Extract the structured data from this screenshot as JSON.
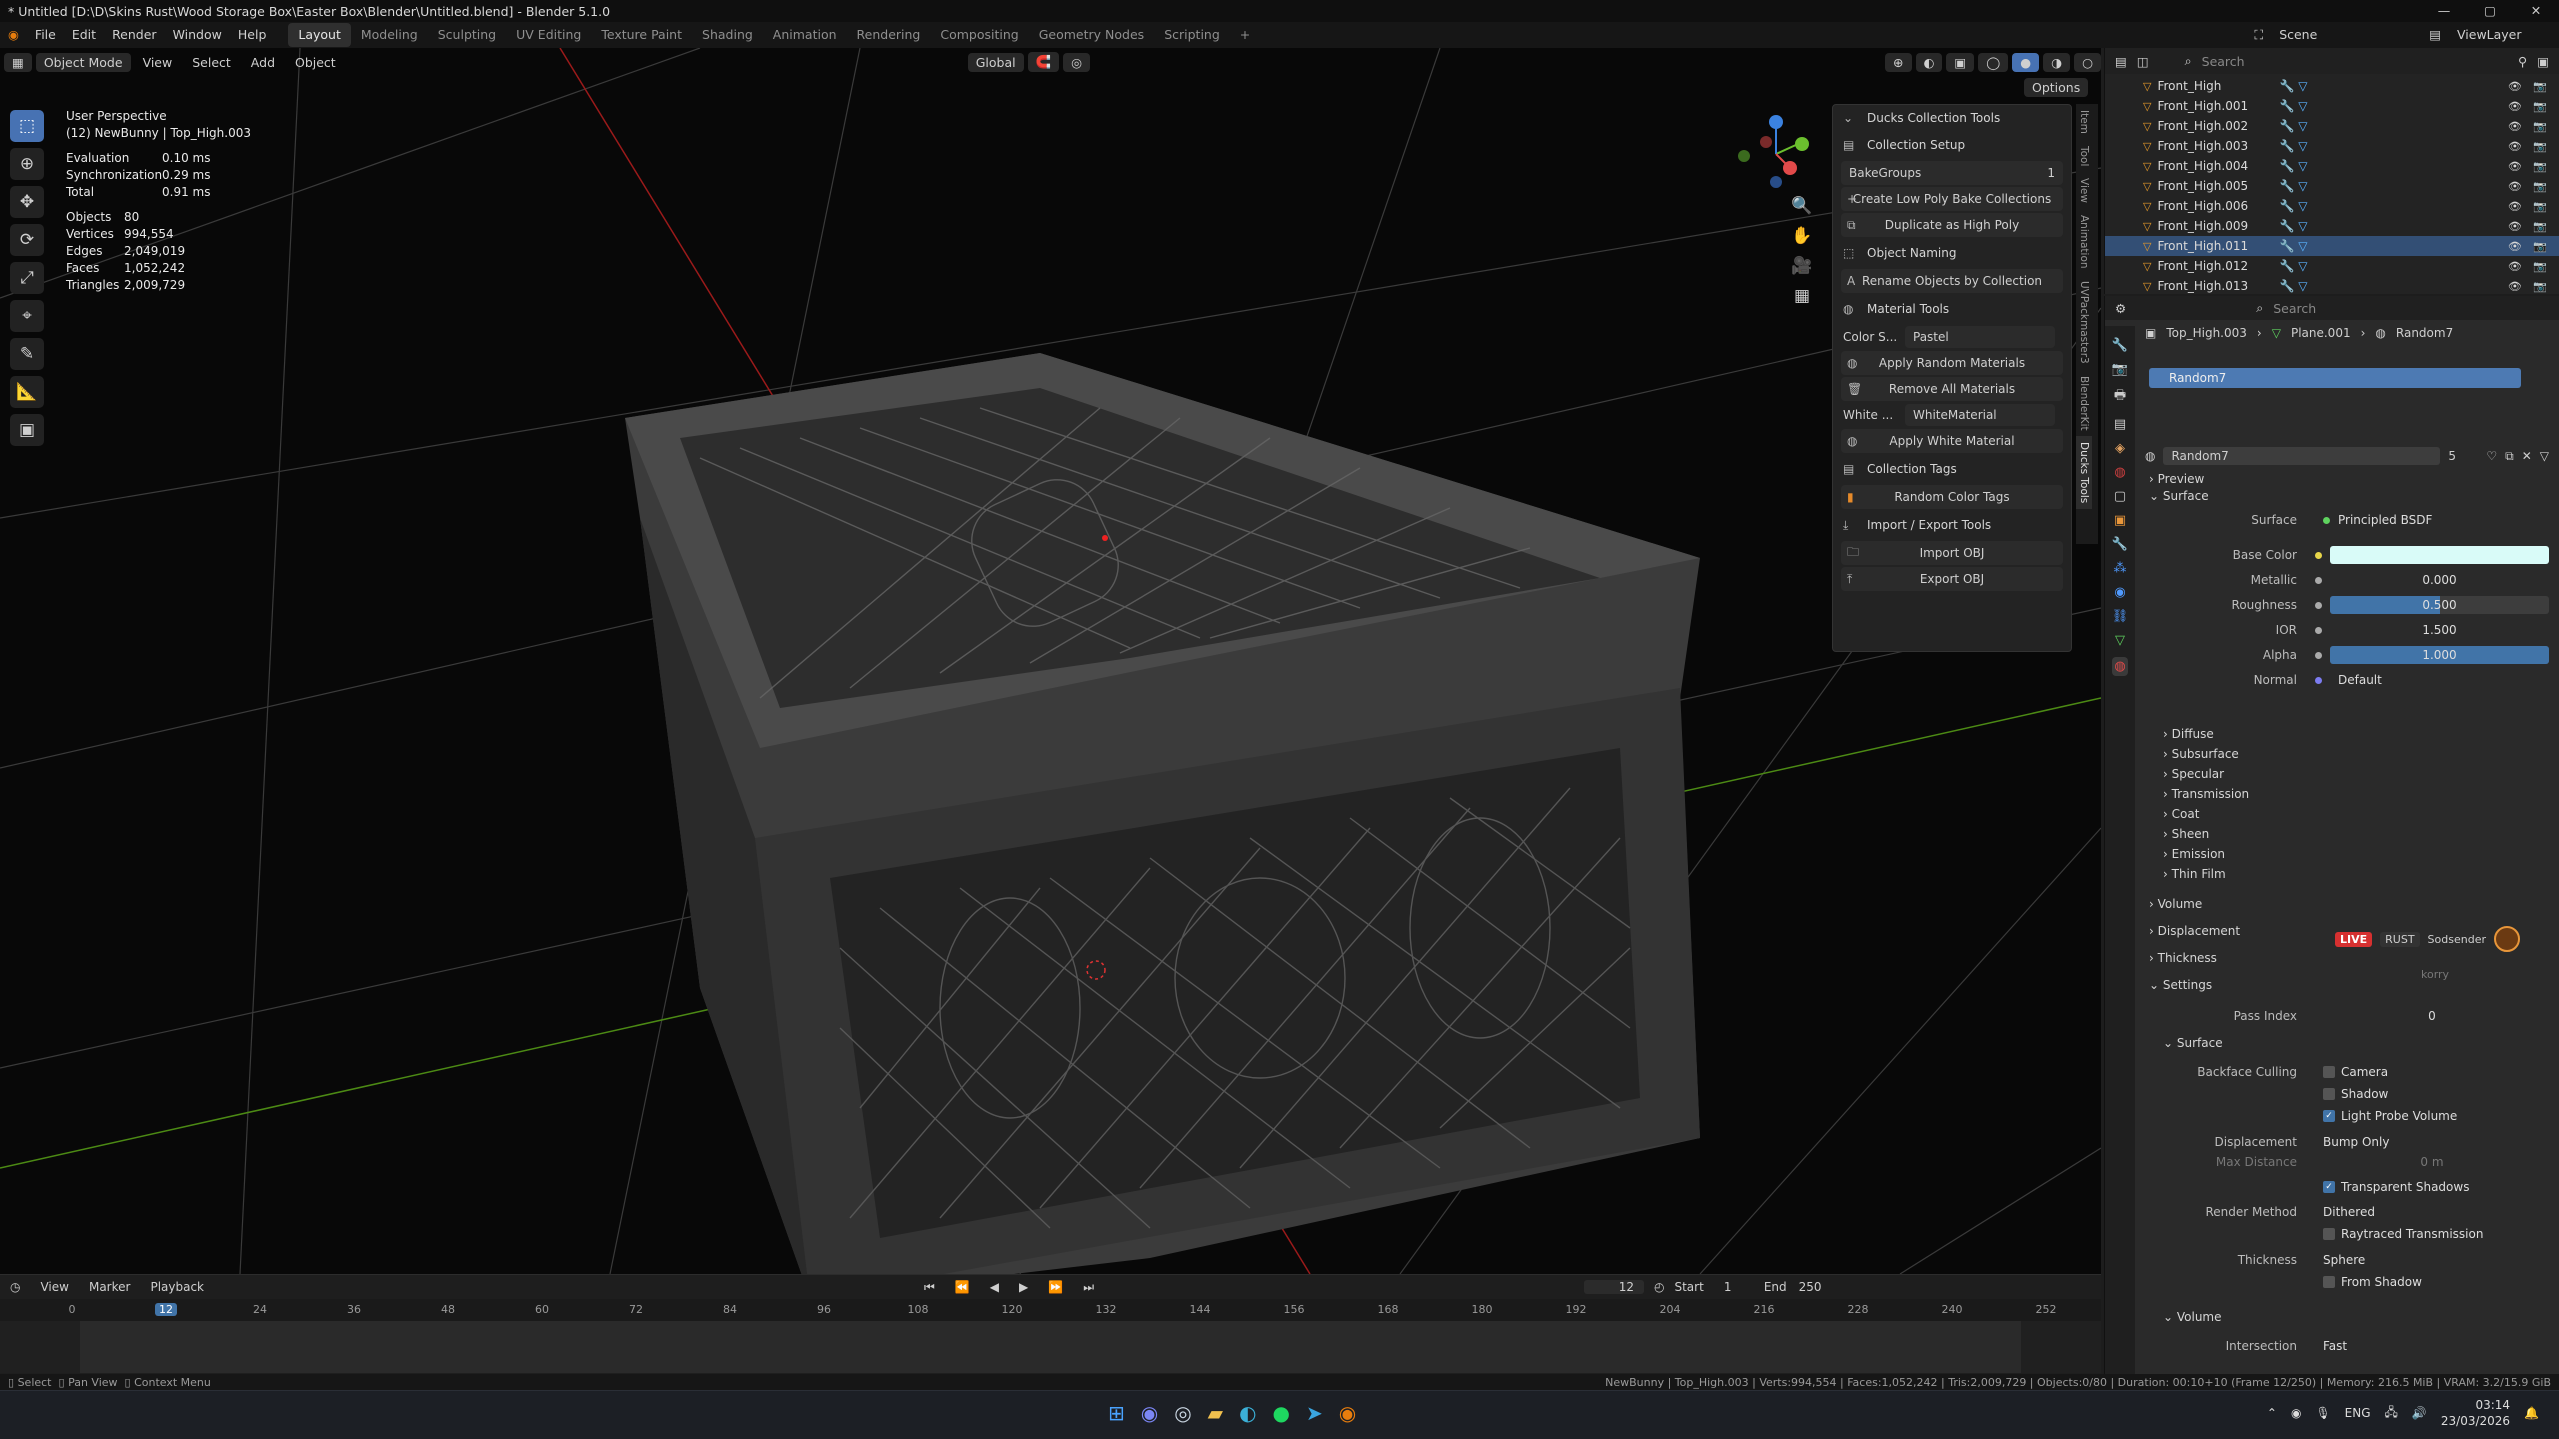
{
  "window": {
    "title": "* Untitled [D:\\D\\Skins Rust\\Wood Storage Box\\Easter Box\\Blender\\Untitled.blend] - Blender 5.1.0"
  },
  "menu": [
    "File",
    "Edit",
    "Render",
    "Window",
    "Help"
  ],
  "workspaces": [
    "Layout",
    "Modeling",
    "Sculpting",
    "UV Editing",
    "Texture Paint",
    "Shading",
    "Animation",
    "Rendering",
    "Compositing",
    "Geometry Nodes",
    "Scripting"
  ],
  "scene": {
    "label": "Scene",
    "view_layer": "ViewLayer"
  },
  "viewport_header": {
    "mode": "Object Mode",
    "view": "View",
    "select": "Select",
    "add": "Add",
    "object": "Object",
    "transform": "Global",
    "options": "Options"
  },
  "overlay": {
    "perspective": "User Perspective",
    "object": "(12) NewBunny | Top_High.003",
    "timing": [
      [
        "Evaluation",
        "0.10 ms"
      ],
      [
        "Synchronization",
        "0.29 ms"
      ],
      [
        "Total",
        "0.91 ms"
      ]
    ],
    "stats": [
      [
        "Objects",
        "80"
      ],
      [
        "Vertices",
        "994,554"
      ],
      [
        "Edges",
        "2,049,019"
      ],
      [
        "Faces",
        "1,052,242"
      ],
      [
        "Triangles",
        "2,009,729"
      ]
    ]
  },
  "ducks_panel": {
    "title": "Ducks Collection Tools",
    "collection_setup": "Collection Setup",
    "bake_groups_label": "BakeGroups",
    "bake_groups_value": "1",
    "create_low_poly": "Create Low Poly Bake Collections",
    "duplicate_high": "Duplicate as High Poly",
    "object_naming": "Object Naming",
    "rename_objects": "Rename Objects by Collection",
    "material_tools": "Material Tools",
    "color_scheme_label": "Color S...",
    "color_scheme_value": "Pastel",
    "apply_random": "Apply Random Materials",
    "remove_all": "Remove All Materials",
    "white_label": "White ...",
    "white_value": "WhiteMaterial",
    "apply_white": "Apply White Material",
    "collection_tags": "Collection Tags",
    "random_color_tags": "Random Color Tags",
    "import_export": "Import / Export Tools",
    "import_obj": "Import OBJ",
    "export_obj": "Export OBJ"
  },
  "side_tabs": [
    "Item",
    "Tool",
    "View",
    "Animation",
    "UVPackmaster3",
    "BlenderKit",
    "Ducks Tools"
  ],
  "outliner": {
    "search": "Search",
    "items": [
      "Front_High",
      "Front_High.001",
      "Front_High.002",
      "Front_High.003",
      "Front_High.004",
      "Front_High.005",
      "Front_High.006",
      "Front_High.009",
      "Front_High.011",
      "Front_High.012",
      "Front_High.013"
    ],
    "selected": "Front_High.011"
  },
  "properties": {
    "search": "Search",
    "breadcrumb": [
      "Top_High.003",
      "Plane.001",
      "Random7"
    ],
    "slot": "Random7",
    "material_name": "Random7",
    "users": "5",
    "sections": {
      "preview": "Preview",
      "surface": "Surface"
    },
    "surface_shader_label": "Surface",
    "surface_shader": "Principled BSDF",
    "base_color_label": "Base Color",
    "base_color": "#d9fbf8",
    "metallic_label": "Metallic",
    "metallic": "0.000",
    "roughness_label": "Roughness",
    "roughness": "0.500",
    "roughness_fill": 0.5,
    "ior_label": "IOR",
    "ior": "1.500",
    "alpha_label": "Alpha",
    "alpha": "1.000",
    "alpha_fill": 1.0,
    "normal_label": "Normal",
    "normal": "Default",
    "subpanels": [
      "Diffuse",
      "Subsurface",
      "Specular",
      "Transmission",
      "Coat",
      "Sheen",
      "Emission",
      "Thin Film"
    ],
    "more_sections": [
      "Volume",
      "Displacement",
      "Thickness",
      "Settings"
    ],
    "live_badge": "LIVE",
    "live_name": "RUST",
    "live_user": "Sodsender",
    "live_sub": "korry",
    "pass_index_label": "Pass Index",
    "pass_index": "0",
    "settings_surface": "Surface",
    "backface_label": "Backface Culling",
    "camera": "Camera",
    "shadow": "Shadow",
    "light_probe": "Light Probe Volume",
    "displacement_label": "Displacement",
    "displacement": "Bump Only",
    "max_distance_label": "Max Distance",
    "max_distance": "0 m",
    "transparent_shadows": "Transparent Shadows",
    "render_method_label": "Render Method",
    "render_method": "Dithered",
    "raytraced": "Raytraced Transmission",
    "thickness_label": "Thickness",
    "thickness": "Sphere",
    "from_shadow": "From Shadow",
    "volume2": "Volume",
    "intersection_label": "Intersection",
    "intersection": "Fast"
  },
  "timeline": {
    "menu": [
      "View",
      "Marker",
      "Playback"
    ],
    "current_frame": "12",
    "start_label": "Start",
    "start": "1",
    "end_label": "End",
    "end": "250",
    "ticks": [
      "0",
      "12",
      "24",
      "36",
      "48",
      "60",
      "72",
      "84",
      "96",
      "108",
      "120",
      "132",
      "144",
      "156",
      "168",
      "180",
      "192",
      "204",
      "216",
      "228",
      "240",
      "252"
    ]
  },
  "statusbar": {
    "hints": [
      "Select",
      "Pan View",
      "Context Menu"
    ],
    "info": "NewBunny | Top_High.003 | Verts:994,554 | Faces:1,052,242 | Tris:2,009,729 | Objects:0/80 | Duration: 00:10+10 (Frame 12/250) | Memory: 216.5 MiB | VRAM: 3.2/15.9 GiB"
  },
  "taskbar": {
    "lang": "ENG",
    "time": "03:14",
    "date": "23/03/2026"
  }
}
